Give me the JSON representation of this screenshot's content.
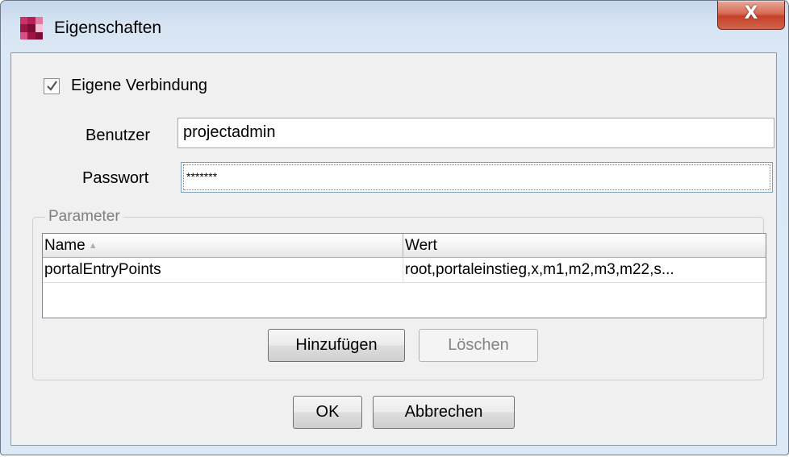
{
  "window": {
    "title": "Eigenschaften",
    "close_label": "X"
  },
  "connection": {
    "own_connection_label": "Eigene Verbindung",
    "own_connection_checked": true,
    "user_label": "Benutzer",
    "user_value": "projectadmin",
    "password_label": "Passwort",
    "password_value": "*******"
  },
  "parameters": {
    "group_label": "Parameter",
    "columns": [
      "Name",
      "Wert"
    ],
    "rows": [
      {
        "name": "portalEntryPoints",
        "value": "root,portaleinstieg,x,m1,m2,m3,m22,s..."
      }
    ],
    "add_button": "Hinzufügen",
    "delete_button": "Löschen"
  },
  "footer": {
    "ok_button": "OK",
    "cancel_button": "Abbrechen"
  },
  "colors": {
    "close_button": "#c6402a",
    "app_icon": "#b0184c"
  }
}
